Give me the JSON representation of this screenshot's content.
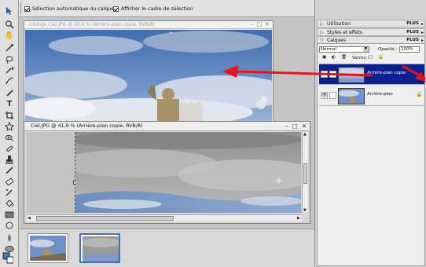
{
  "options_bar": {
    "auto_select_label": "Sélection automatique du calque",
    "show_bbox_label": "Afficher le cadre de sélection"
  },
  "tools": [
    "move-tool",
    "zoom-tool",
    "hand-tool",
    "eyedropper-tool",
    "lasso-tool",
    "magic-wand-tool",
    "crop-tool",
    "healing-brush-tool",
    "text-tool",
    "crop-tool-2",
    "cookie-cutter-tool",
    "red-eye-tool",
    "brush-tool",
    "eraser-tool",
    "paint-bucket-tool",
    "gradient-tool",
    "shape-tool",
    "blur-tool",
    "sponge-tool",
    "clone-stamp-tool"
  ],
  "window_back": {
    "title": "Cielogo Ciel.JPG @ 20,8 % (Arrière-plan copie, RVB/8)"
  },
  "window_front": {
    "title": "Ciel.JPG @ 41,9 % (Arrière-plan copie, RVB/8)"
  },
  "panels": {
    "utilisation": {
      "label": "Utilisation",
      "plus": "PLUS"
    },
    "styles": {
      "label": "Styles et effets",
      "plus": "PLUS"
    },
    "calques": {
      "label": "Calques",
      "plus": "PLUS"
    }
  },
  "layers_panel": {
    "blend_mode": "Normal",
    "opacity_label": "Opacité :",
    "opacity_value": "100%",
    "lock_label": "Verrou :",
    "layers": [
      {
        "name": "Arrière-plan copie",
        "active": true
      },
      {
        "name": "Arrière-plan",
        "active": false
      }
    ]
  },
  "colors": {
    "active_layer": "#0b1f8e",
    "arrow": "#e8121a",
    "selection_border": "#4a6fb5"
  }
}
